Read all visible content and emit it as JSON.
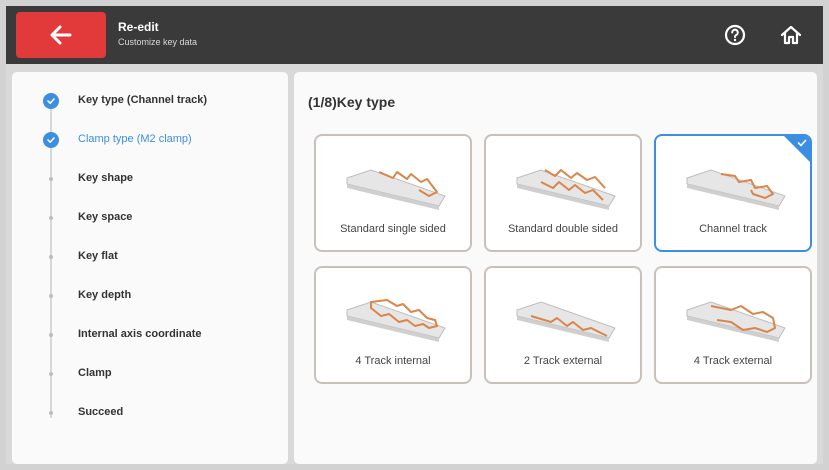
{
  "header": {
    "title": "Re-edit",
    "subtitle": "Customize key data",
    "icons": {
      "back": "arrow-left-icon",
      "help": "help-circle-icon",
      "home": "home-icon"
    },
    "accent_color": "#e23a3a"
  },
  "steps": [
    {
      "label": "Key type (Channel track)",
      "state": "done"
    },
    {
      "label": "Clamp type (M2 clamp)",
      "state": "active"
    },
    {
      "label": "Key shape",
      "state": "pending"
    },
    {
      "label": "Key space",
      "state": "pending"
    },
    {
      "label": "Key flat",
      "state": "pending"
    },
    {
      "label": "Key depth",
      "state": "pending"
    },
    {
      "label": "Internal axis coordinate",
      "state": "pending"
    },
    {
      "label": "Clamp",
      "state": "pending"
    },
    {
      "label": "Succeed",
      "state": "pending"
    }
  ],
  "main": {
    "section_title": "(1/8)Key type",
    "options": [
      {
        "label": "Standard single sided",
        "selected": false
      },
      {
        "label": "Standard double sided",
        "selected": false
      },
      {
        "label": "Channel track",
        "selected": true
      },
      {
        "label": "4 Track internal",
        "selected": false
      },
      {
        "label": "2 Track external",
        "selected": false
      },
      {
        "label": "4 Track external",
        "selected": false
      }
    ],
    "selected_color": "#3b8ee2",
    "key_cut_color": "#d9864a"
  }
}
